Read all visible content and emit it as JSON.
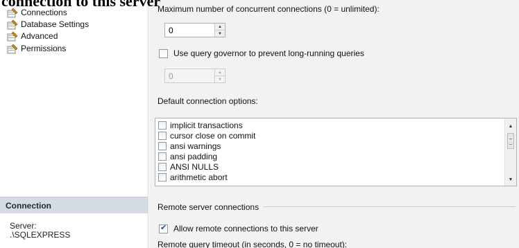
{
  "overlay": {
    "heading": "connection to this server"
  },
  "sidebar": {
    "items": [
      {
        "label": "Connections",
        "icon": "wrench-page-icon"
      },
      {
        "label": "Database Settings",
        "icon": "wrench-page-icon"
      },
      {
        "label": "Advanced",
        "icon": "wrench-page-icon"
      },
      {
        "label": "Permissions",
        "icon": "wrench-page-icon"
      }
    ],
    "connection": {
      "header": "Connection",
      "server_label": "Server:",
      "server_value": ".\\SQLEXPRESS"
    }
  },
  "main": {
    "max_connections": {
      "label": "Maximum number of concurrent connections (0 = unlimited):",
      "value": "0"
    },
    "query_governor": {
      "label": "Use query governor to prevent long-running queries",
      "checked": false,
      "value": "0"
    },
    "default_options": {
      "label": "Default connection options:",
      "items": [
        {
          "label": "implicit transactions",
          "checked": false
        },
        {
          "label": "cursor close on commit",
          "checked": false
        },
        {
          "label": "ansi warnings",
          "checked": false
        },
        {
          "label": "ansi padding",
          "checked": false
        },
        {
          "label": "ANSI NULLS",
          "checked": false
        },
        {
          "label": "arithmetic abort",
          "checked": false
        }
      ]
    },
    "remote": {
      "group_label": "Remote server connections",
      "allow_label": "Allow remote connections to this server",
      "allow_checked": true,
      "timeout_label": "Remote query timeout (in seconds, 0 = no timeout):"
    }
  },
  "colors": {
    "sidebar_header_bg": "#d5dbe3",
    "main_bg": "#f2f2f2",
    "input_border": "#a9b0ba"
  }
}
